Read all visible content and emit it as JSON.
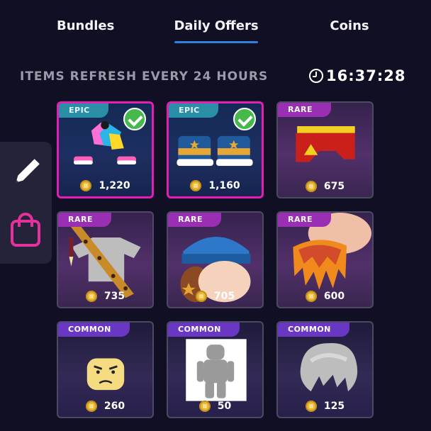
{
  "tabs": [
    {
      "label": "Bundles",
      "selected": false
    },
    {
      "label": "Daily Offers",
      "selected": true
    },
    {
      "label": "Coins",
      "selected": false
    }
  ],
  "refresh_text": "ITEMS REFRESH EVERY 24 HOURS",
  "timer": "16:37:28",
  "sidebar": {
    "items": [
      {
        "icon": "pencil-icon"
      },
      {
        "icon": "shopping-bag-icon"
      }
    ]
  },
  "colors": {
    "accent_tab": "#2f7fe0",
    "epic_border": "#e21fb2",
    "epic_badge": "#2a8fa6",
    "rare_badge": "#9b2fb4",
    "common_badge": "#6a36c4",
    "coin": "#e8b73a",
    "check": "#47b84c"
  },
  "offers": [
    {
      "rarity": "EPIC",
      "price": "1,220",
      "owned": true,
      "item": "neon-outfit"
    },
    {
      "rarity": "EPIC",
      "price": "1,160",
      "owned": true,
      "item": "star-sneakers"
    },
    {
      "rarity": "RARE",
      "price": "675",
      "owned": false,
      "item": "red-shorts"
    },
    {
      "rarity": "RARE",
      "price": "735",
      "owned": false,
      "item": "leopard-shirt-with-belt"
    },
    {
      "rarity": "RARE",
      "price": "705",
      "owned": false,
      "item": "blue-beanie-with-hair"
    },
    {
      "rarity": "RARE",
      "price": "600",
      "owned": false,
      "item": "flame-hair"
    },
    {
      "rarity": "COMMON",
      "price": "260",
      "owned": false,
      "item": "angry-face"
    },
    {
      "rarity": "COMMON",
      "price": "50",
      "owned": false,
      "item": "grey-body"
    },
    {
      "rarity": "COMMON",
      "price": "125",
      "owned": false,
      "item": "grey-hair"
    }
  ]
}
